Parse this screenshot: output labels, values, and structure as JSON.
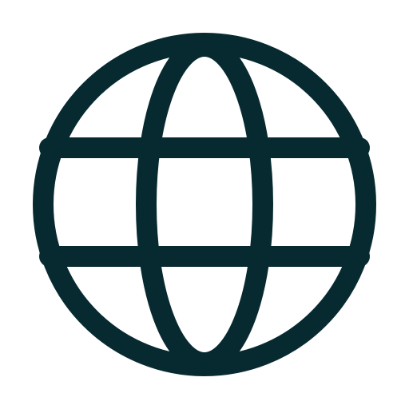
{
  "icon": {
    "name": "globe-icon",
    "color": "#072a30",
    "background": "#ffffff"
  }
}
